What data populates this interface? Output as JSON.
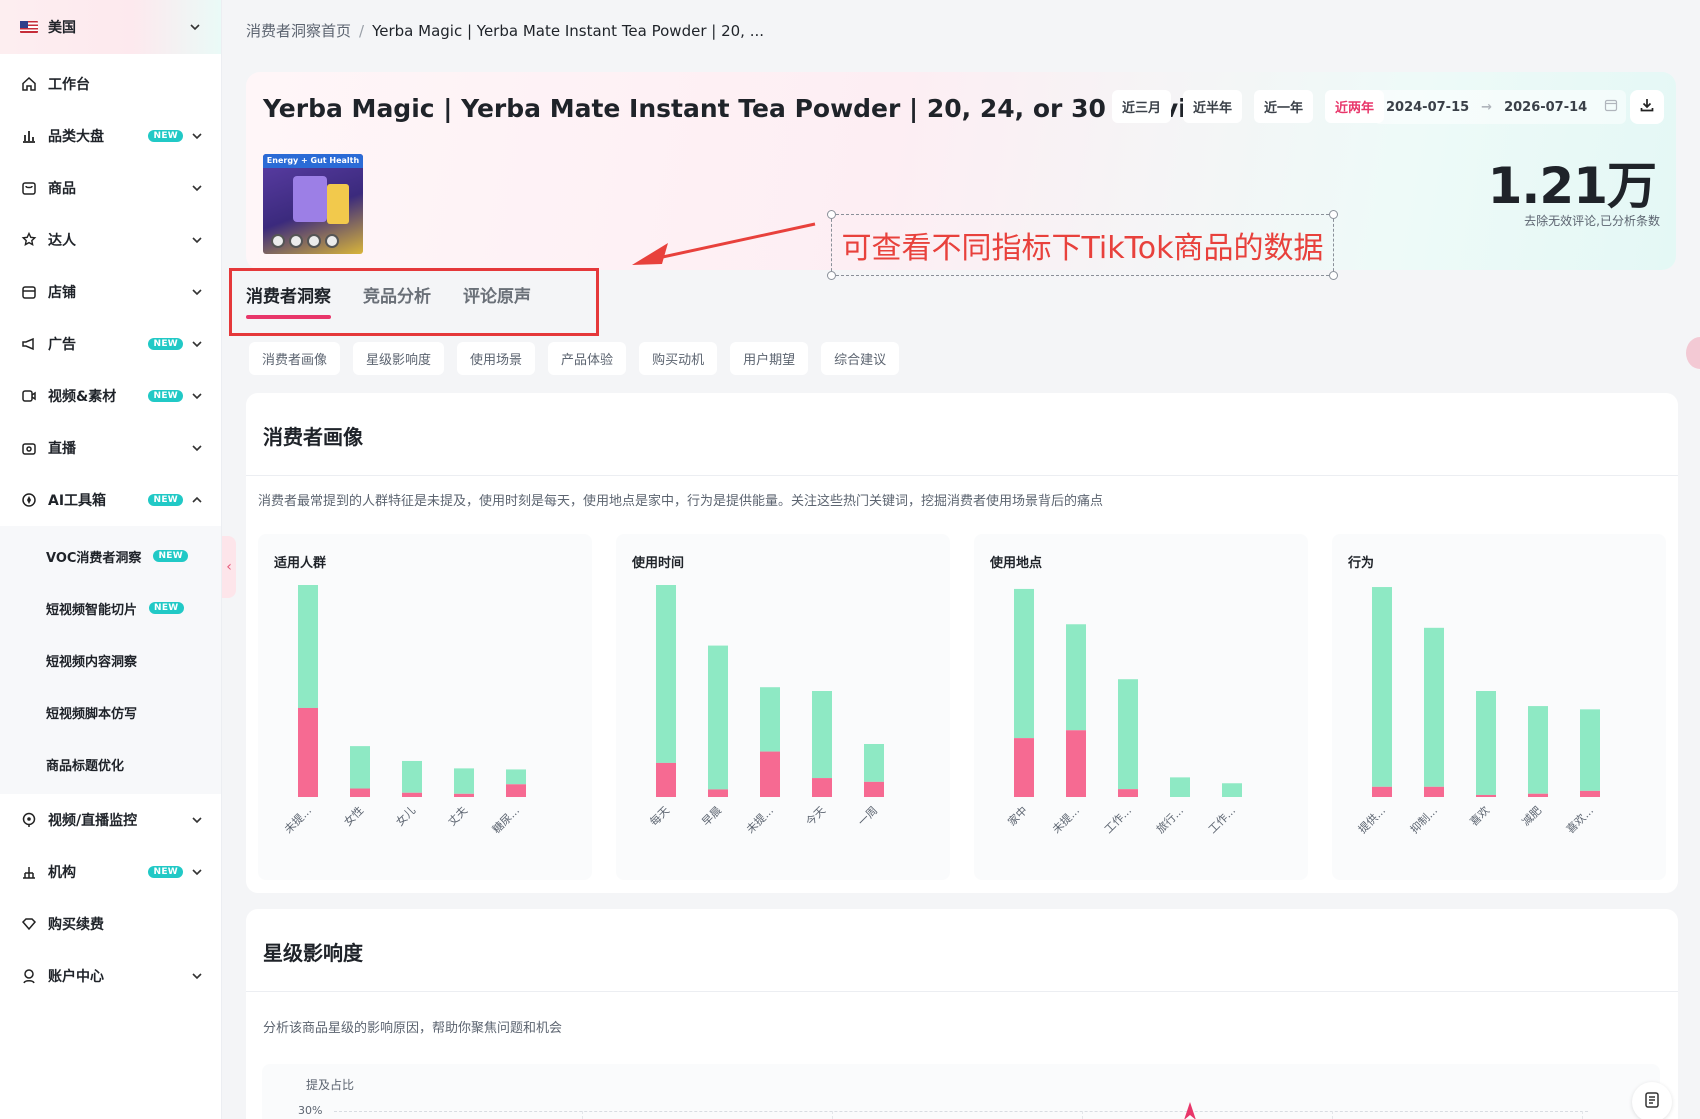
{
  "sidebar": {
    "country": "美国",
    "items": [
      {
        "label": "工作台"
      },
      {
        "label": "品类大盘",
        "badge": "NEW"
      },
      {
        "label": "商品"
      },
      {
        "label": "达人"
      },
      {
        "label": "店铺"
      },
      {
        "label": "广告",
        "badge": "NEW"
      },
      {
        "label": "视频&素材",
        "badge": "NEW"
      },
      {
        "label": "直播"
      },
      {
        "label": "AI工具箱",
        "badge": "NEW"
      }
    ],
    "ai_sub": [
      {
        "label": "VOC消费者洞察",
        "badge": "NEW"
      },
      {
        "label": "短视频智能切片",
        "badge": "NEW"
      },
      {
        "label": "短视频内容洞察"
      },
      {
        "label": "短视频脚本仿写"
      },
      {
        "label": "商品标题优化"
      }
    ],
    "items_after": [
      {
        "label": "视频/直播监控"
      },
      {
        "label": "机构",
        "badge": "NEW"
      },
      {
        "label": "购买续费"
      },
      {
        "label": "账户中心"
      }
    ]
  },
  "breadcrumb": {
    "home": "消费者洞察首页",
    "separator": "/",
    "current": "Yerba Magic | Yerba Mate Instant Tea Powder | 20, ..."
  },
  "header": {
    "title": "Yerba Magic | Yerba Mate Instant Tea Powder | 20, 24, or 30 Servin...",
    "thumb_text": "Energy + Gut Health",
    "ranges": [
      "近三月",
      "近半年",
      "近一年",
      "近两年"
    ],
    "active_range_index": 3,
    "date_start": "2024-07-15",
    "date_arrow": "→",
    "date_end": "2026-07-14",
    "metric_value": "1.21万",
    "metric_caption": "去除无效评论,已分析条数"
  },
  "annotation": {
    "text": "可查看不同指标下TikTok商品的数据",
    "color": "#e8413c"
  },
  "tabs": [
    "消费者洞察",
    "竞品分析",
    "评论原声"
  ],
  "active_tab_index": 0,
  "chips": [
    "消费者画像",
    "星级影响度",
    "使用场景",
    "产品体验",
    "购买动机",
    "用户期望",
    "综合建议"
  ],
  "section1": {
    "title": "消费者画像",
    "description": "消费者最常提到的人群特征是未提及，使用时刻是每天，使用地点是家中，行为是提供能量。关注这些热门关键词，挖掘消费者使用场景背后的痛点"
  },
  "section2": {
    "title": "星级影响度",
    "description": "分析该商品星级的影响原因，帮助你聚焦问题和机会",
    "y_label": "提及占比",
    "y_tick": "30%"
  },
  "colors": {
    "positive": "#8ee9c4",
    "negative": "#f66a92",
    "accent": "#e8366a"
  },
  "chart_data": [
    {
      "type": "bar",
      "stacked": true,
      "title": "适用人群",
      "categories": [
        "未提...",
        "女性",
        "女儿",
        "丈夫",
        "糖尿..."
      ],
      "series": [
        {
          "values": [
            42,
            4,
            2,
            1.5,
            6
          ]
        },
        {
          "values": [
            58,
            20,
            15,
            12,
            7
          ]
        }
      ],
      "ymax": 100
    },
    {
      "type": "bar",
      "stacked": true,
      "title": "使用时间",
      "categories": [
        "每天",
        "早晨",
        "未提...",
        "今天",
        "一周"
      ],
      "series": [
        {
          "values": [
            9,
            2,
            12,
            5,
            4
          ]
        },
        {
          "values": [
            47,
            38,
            17,
            23,
            10
          ]
        }
      ],
      "ymax": 56
    },
    {
      "type": "bar",
      "stacked": true,
      "title": "使用地点",
      "categories": [
        "家中",
        "未提...",
        "工作...",
        "旅行...",
        "工作..."
      ],
      "series": [
        {
          "values": [
            15,
            17,
            2,
            0,
            0
          ]
        },
        {
          "values": [
            38,
            27,
            28,
            5,
            3.5
          ]
        }
      ],
      "ymax": 54
    },
    {
      "type": "bar",
      "stacked": true,
      "title": "行为",
      "categories": [
        "提供...",
        "抑制...",
        "喜欢",
        "减肥",
        "喜欢..."
      ],
      "series": [
        {
          "values": [
            2.5,
            2.5,
            0.5,
            0.8,
            1.5
          ]
        },
        {
          "values": [
            49,
            39,
            25.5,
            21.5,
            20
          ]
        }
      ],
      "ymax": 52
    }
  ]
}
